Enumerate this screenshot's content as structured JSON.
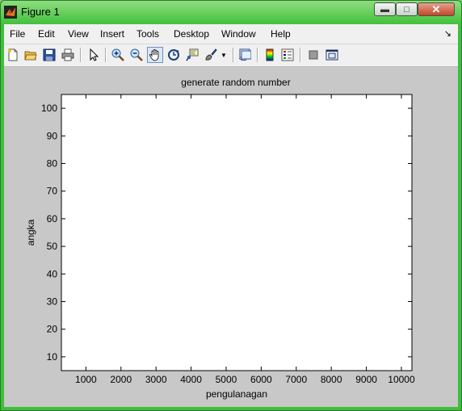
{
  "window": {
    "title": "Figure 1"
  },
  "menubar": {
    "items": [
      "File",
      "Edit",
      "View",
      "Insert",
      "Tools",
      "Desktop",
      "Window",
      "Help"
    ]
  },
  "toolbar": {
    "icons": [
      "new-figure-icon",
      "open-file-icon",
      "save-icon",
      "print-icon",
      "select-arrow-icon",
      "zoom-in-icon",
      "zoom-out-icon",
      "pan-hand-icon",
      "rotate-3d-icon",
      "data-cursor-icon",
      "brush-icon",
      "link-plot-icon",
      "colorbar-icon",
      "legend-icon",
      "hide-plot-tools-icon",
      "show-plot-tools-icon"
    ]
  },
  "chart_data": {
    "type": "line",
    "title": "generate random number",
    "xlabel": "pengulanagan",
    "ylabel": "angka",
    "xlim": [
      300,
      10300
    ],
    "ylim": [
      5,
      105
    ],
    "xticks": [
      1000,
      2000,
      3000,
      4000,
      5000,
      6000,
      7000,
      8000,
      9000,
      10000
    ],
    "yticks": [
      10,
      20,
      30,
      40,
      50,
      60,
      70,
      80,
      90,
      100
    ],
    "series": [],
    "grid": false
  }
}
